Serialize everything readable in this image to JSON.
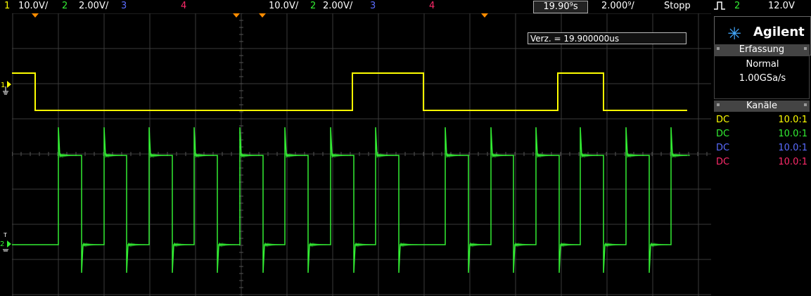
{
  "top": {
    "ch1_num": "1",
    "ch1_scale": "10.0V/",
    "ch2_num": "2",
    "ch2_scale": "2.00V/",
    "ch3_num": "3",
    "ch4_num": "4",
    "right_ch1_scale": "10.0V/",
    "right_ch2_num": "2",
    "right_ch2_scale": "2.00V/",
    "right_ch3_num": "3",
    "right_ch4_num": "4",
    "time_delay": "19.90⁹s",
    "timebase": "2.000⁹/",
    "run_state": "Stopp",
    "trigger_icon": "rising-edge-trigger",
    "trigger_source": "2",
    "trigger_level": "12.0V"
  },
  "readout": {
    "delay_text": "Verz. = 19.900000us"
  },
  "panel": {
    "brand": "Agilent",
    "acq_title": "Erfassung",
    "acq_mode": "Normal",
    "acq_rate": "1.00GSa/s",
    "channels_title": "Kanäle",
    "channels": [
      {
        "coupling": "DC",
        "probe": "10.0:1",
        "color": "#ffff00"
      },
      {
        "coupling": "DC",
        "probe": "10.0:1",
        "color": "#33ee33"
      },
      {
        "coupling": "DC",
        "probe": "10.0:1",
        "color": "#5a6cff"
      },
      {
        "coupling": "DC",
        "probe": "10.0:1",
        "color": "#ff2a6a"
      }
    ]
  },
  "markers": {
    "ch1_label": "1",
    "ch2_label": "2"
  },
  "traces": {
    "ch1_color": "#ffff00",
    "ch2_color": "#33ee33",
    "ch1_high_intervals_us": [
      [
        -19.8,
        -18.0
      ],
      [
        6.8,
        12.6
      ],
      [
        23.6,
        27.4
      ]
    ],
    "ch2_pulse_period_us": 3.7
  }
}
